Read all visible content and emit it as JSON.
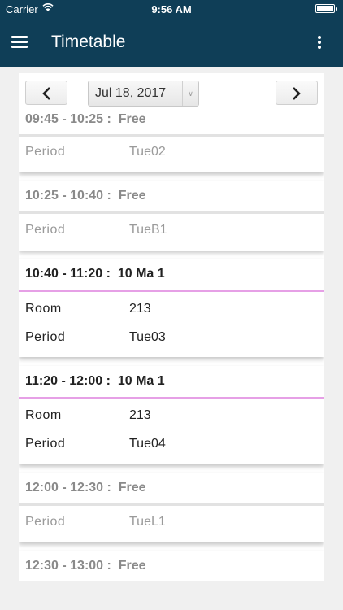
{
  "status_bar": {
    "carrier": "Carrier",
    "time": "9:56 AM",
    "battery_level": 1.0
  },
  "header": {
    "title": "Timetable",
    "menu_icon": "hamburger-menu-icon",
    "more_icon": "vertical-ellipsis-icon",
    "color": "#0f3e57"
  },
  "date_picker": {
    "prev_icon": "chevron-left-icon",
    "next_icon": "chevron-right-icon",
    "date": "Jul 18, 2017",
    "caret": "∨"
  },
  "entries": [
    {
      "time": "09:45 - 10:25 :",
      "subject": "Free",
      "rows": [
        {
          "label": "Period",
          "value": "Tue02"
        }
      ],
      "status": "free"
    },
    {
      "time": "10:25 - 10:40 :",
      "subject": "Free",
      "rows": [
        {
          "label": "Period",
          "value": "TueB1"
        }
      ],
      "status": "free"
    },
    {
      "time": "10:40 - 11:20 :",
      "subject": "10 Ma 1",
      "rows": [
        {
          "label": "Room",
          "value": "213"
        },
        {
          "label": "Period",
          "value": "Tue03"
        }
      ],
      "status": "lesson"
    },
    {
      "time": "11:20 - 12:00 :",
      "subject": "10 Ma 1",
      "rows": [
        {
          "label": "Room",
          "value": "213"
        },
        {
          "label": "Period",
          "value": "Tue04"
        }
      ],
      "status": "lesson"
    },
    {
      "time": "12:00 - 12:30 :",
      "subject": "Free",
      "rows": [
        {
          "label": "Period",
          "value": "TueL1"
        }
      ],
      "status": "free"
    },
    {
      "time": "12:30 - 13:00 :",
      "subject": "Free",
      "rows": [],
      "status": "free"
    }
  ],
  "colors": {
    "lesson_accent": "#e6a0e6",
    "free_text": "#9a9a9a"
  }
}
